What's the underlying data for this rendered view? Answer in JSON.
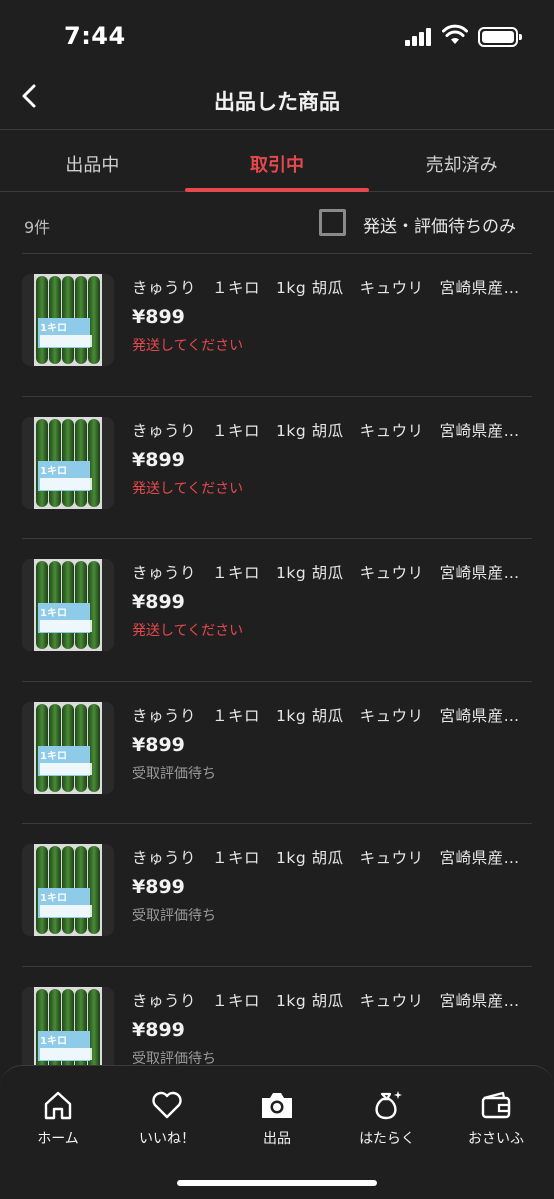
{
  "statusbar": {
    "time": "7:44"
  },
  "header": {
    "title": "出品した商品"
  },
  "tabs": [
    {
      "label": "出品中",
      "active": false
    },
    {
      "label": "取引中",
      "active": true
    },
    {
      "label": "売却済み",
      "active": false
    }
  ],
  "filter": {
    "count": "9件",
    "checkbox_label": "発送・評価待ちのみ",
    "checked": false
  },
  "items": [
    {
      "name": "きゅうり　１キロ　1kg 胡瓜　キュウリ　宮崎県産…",
      "price": "¥899",
      "status": "発送してください",
      "status_type": "red",
      "thumb_label": "1キロ"
    },
    {
      "name": "きゅうり　１キロ　1kg 胡瓜　キュウリ　宮崎県産…",
      "price": "¥899",
      "status": "発送してください",
      "status_type": "red",
      "thumb_label": "1キロ"
    },
    {
      "name": "きゅうり　１キロ　1kg 胡瓜　キュウリ　宮崎県産…",
      "price": "¥899",
      "status": "発送してください",
      "status_type": "red",
      "thumb_label": "1キロ"
    },
    {
      "name": "きゅうり　１キロ　1kg 胡瓜　キュウリ　宮崎県産…",
      "price": "¥899",
      "status": "受取評価待ち",
      "status_type": "gray",
      "thumb_label": "1キロ"
    },
    {
      "name": "きゅうり　１キロ　1kg 胡瓜　キュウリ　宮崎県産…",
      "price": "¥899",
      "status": "受取評価待ち",
      "status_type": "gray",
      "thumb_label": "1キロ"
    },
    {
      "name": "きゅうり　１キロ　1kg 胡瓜　キュウリ　宮崎県産…",
      "price": "¥899",
      "status": "受取評価待ち",
      "status_type": "gray",
      "thumb_label": "1キロ"
    }
  ],
  "bottomnav": [
    {
      "label": "ホーム",
      "icon": "home-icon"
    },
    {
      "label": "いいね！",
      "icon": "heart-icon"
    },
    {
      "label": "出品",
      "icon": "camera-icon"
    },
    {
      "label": "はたらく",
      "icon": "money-bag-icon"
    },
    {
      "label": "おさいふ",
      "icon": "wallet-icon"
    }
  ],
  "colors": {
    "accent": "#e5484d",
    "background": "#1f1f1f",
    "muted": "#9a9a9a"
  }
}
